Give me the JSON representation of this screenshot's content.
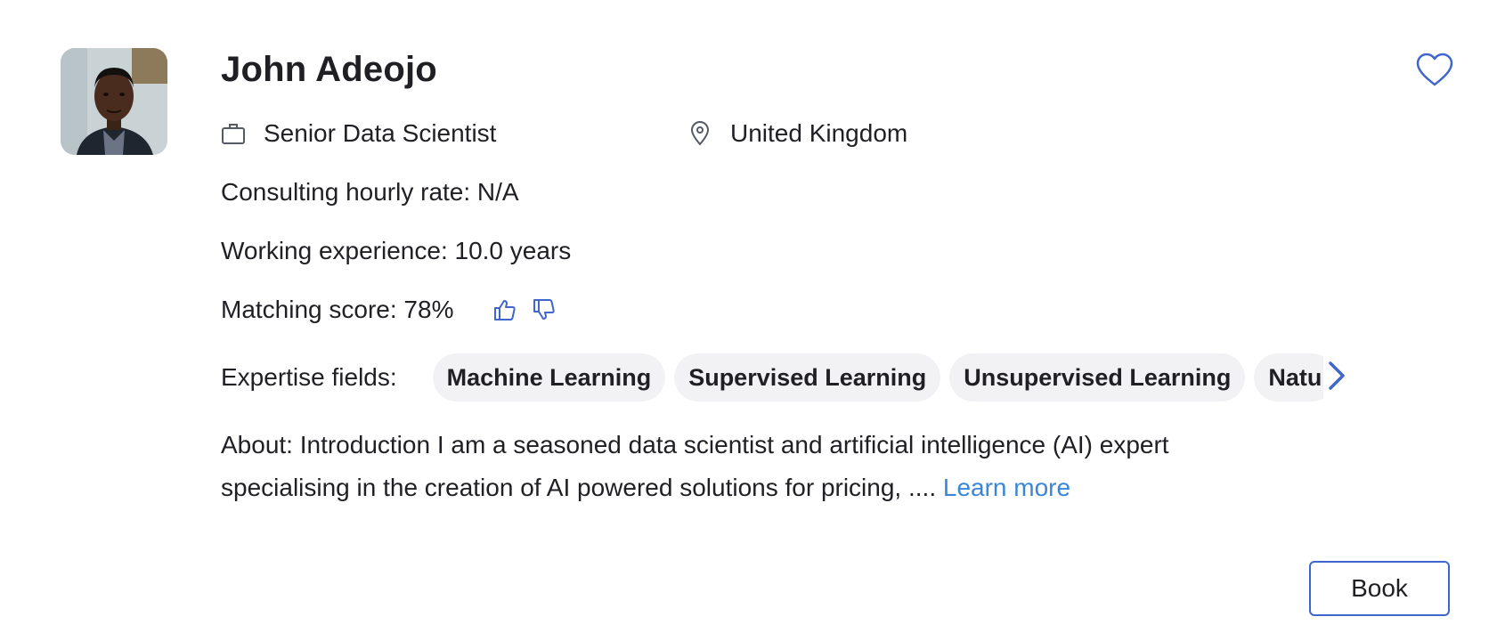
{
  "profile": {
    "name": "John Adeojo",
    "job_title": "Senior Data Scientist",
    "location": "United Kingdom",
    "hourly_rate": "Consulting hourly rate: N/A",
    "experience": "Working experience: 10.0 years",
    "matching_score": "Matching score: 78%",
    "expertise_label": "Expertise fields:",
    "expertise": [
      "Machine Learning",
      "Supervised Learning",
      "Unsupervised Learning",
      "Natu"
    ],
    "about": "About: Introduction I am a seasoned data scientist and artificial intelligence (AI) expert specialising in the creation of AI powered solutions for pricing, ....",
    "learn_more": "Learn more"
  },
  "actions": {
    "book_label": "Book"
  },
  "icons": {
    "favorite": "heart-icon",
    "job": "briefcase-icon",
    "location": "map-pin-icon",
    "like": "thumbs-up-icon",
    "dislike": "thumbs-down-icon",
    "scroll": "chevron-right-icon"
  },
  "colors": {
    "accent": "#3f66cc",
    "link": "#3a86d8",
    "chip_bg": "#f2f2f4",
    "text": "#1f1f24"
  }
}
